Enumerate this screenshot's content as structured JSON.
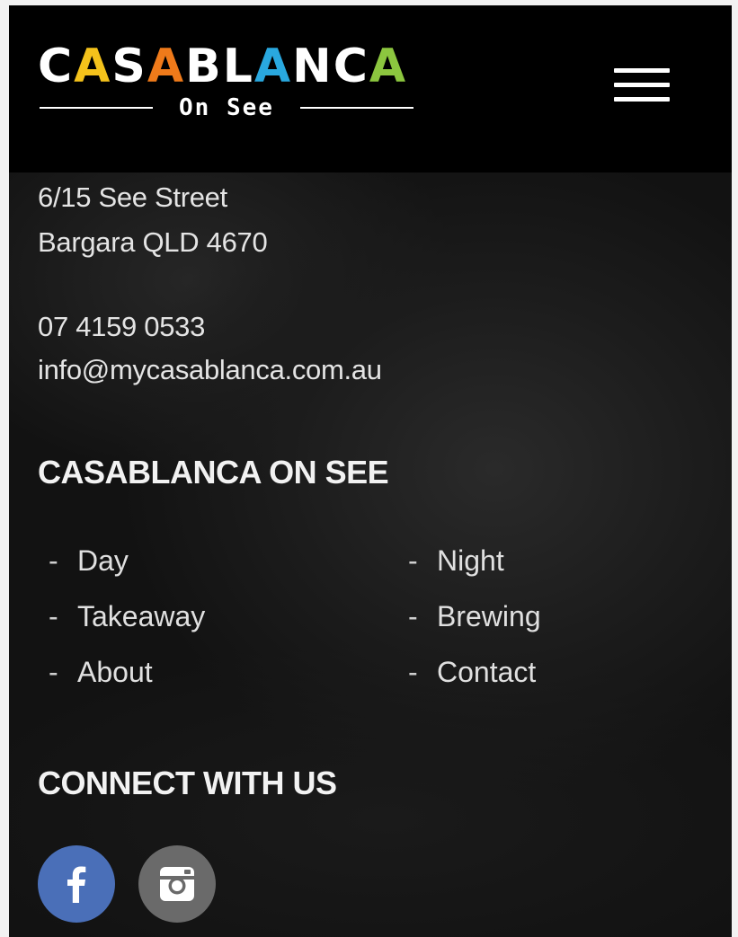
{
  "header": {
    "logo_word": [
      "C",
      "A",
      "S",
      "A",
      "B",
      "L",
      "A",
      "N",
      "C",
      "A"
    ],
    "logo_subtitle": "On See",
    "menu_icon": "hamburger-menu-icon"
  },
  "contact": {
    "address_line1": "6/15 See Street",
    "address_line2": "Bargara QLD 4670",
    "phone": "07 4159 0533",
    "email": "info@mycasablanca.com.au"
  },
  "nav": {
    "heading": "CASABLANCA ON SEE",
    "dash": "-",
    "items": [
      {
        "label": "Day"
      },
      {
        "label": "Night"
      },
      {
        "label": "Takeaway"
      },
      {
        "label": "Brewing"
      },
      {
        "label": "About"
      },
      {
        "label": "Contact"
      }
    ]
  },
  "connect": {
    "heading": "CONNECT WITH US",
    "facebook_icon": "facebook-icon",
    "facebook_color": "#4a6fb8",
    "instagram_icon": "instagram-icon",
    "instagram_color": "#6a6a6a"
  },
  "colors": {
    "logo_yellow": "#f4c21b",
    "logo_orange": "#ef7a1a",
    "logo_blue": "#29a8df",
    "logo_green": "#8cc63f",
    "background": "#0b0b0b"
  }
}
